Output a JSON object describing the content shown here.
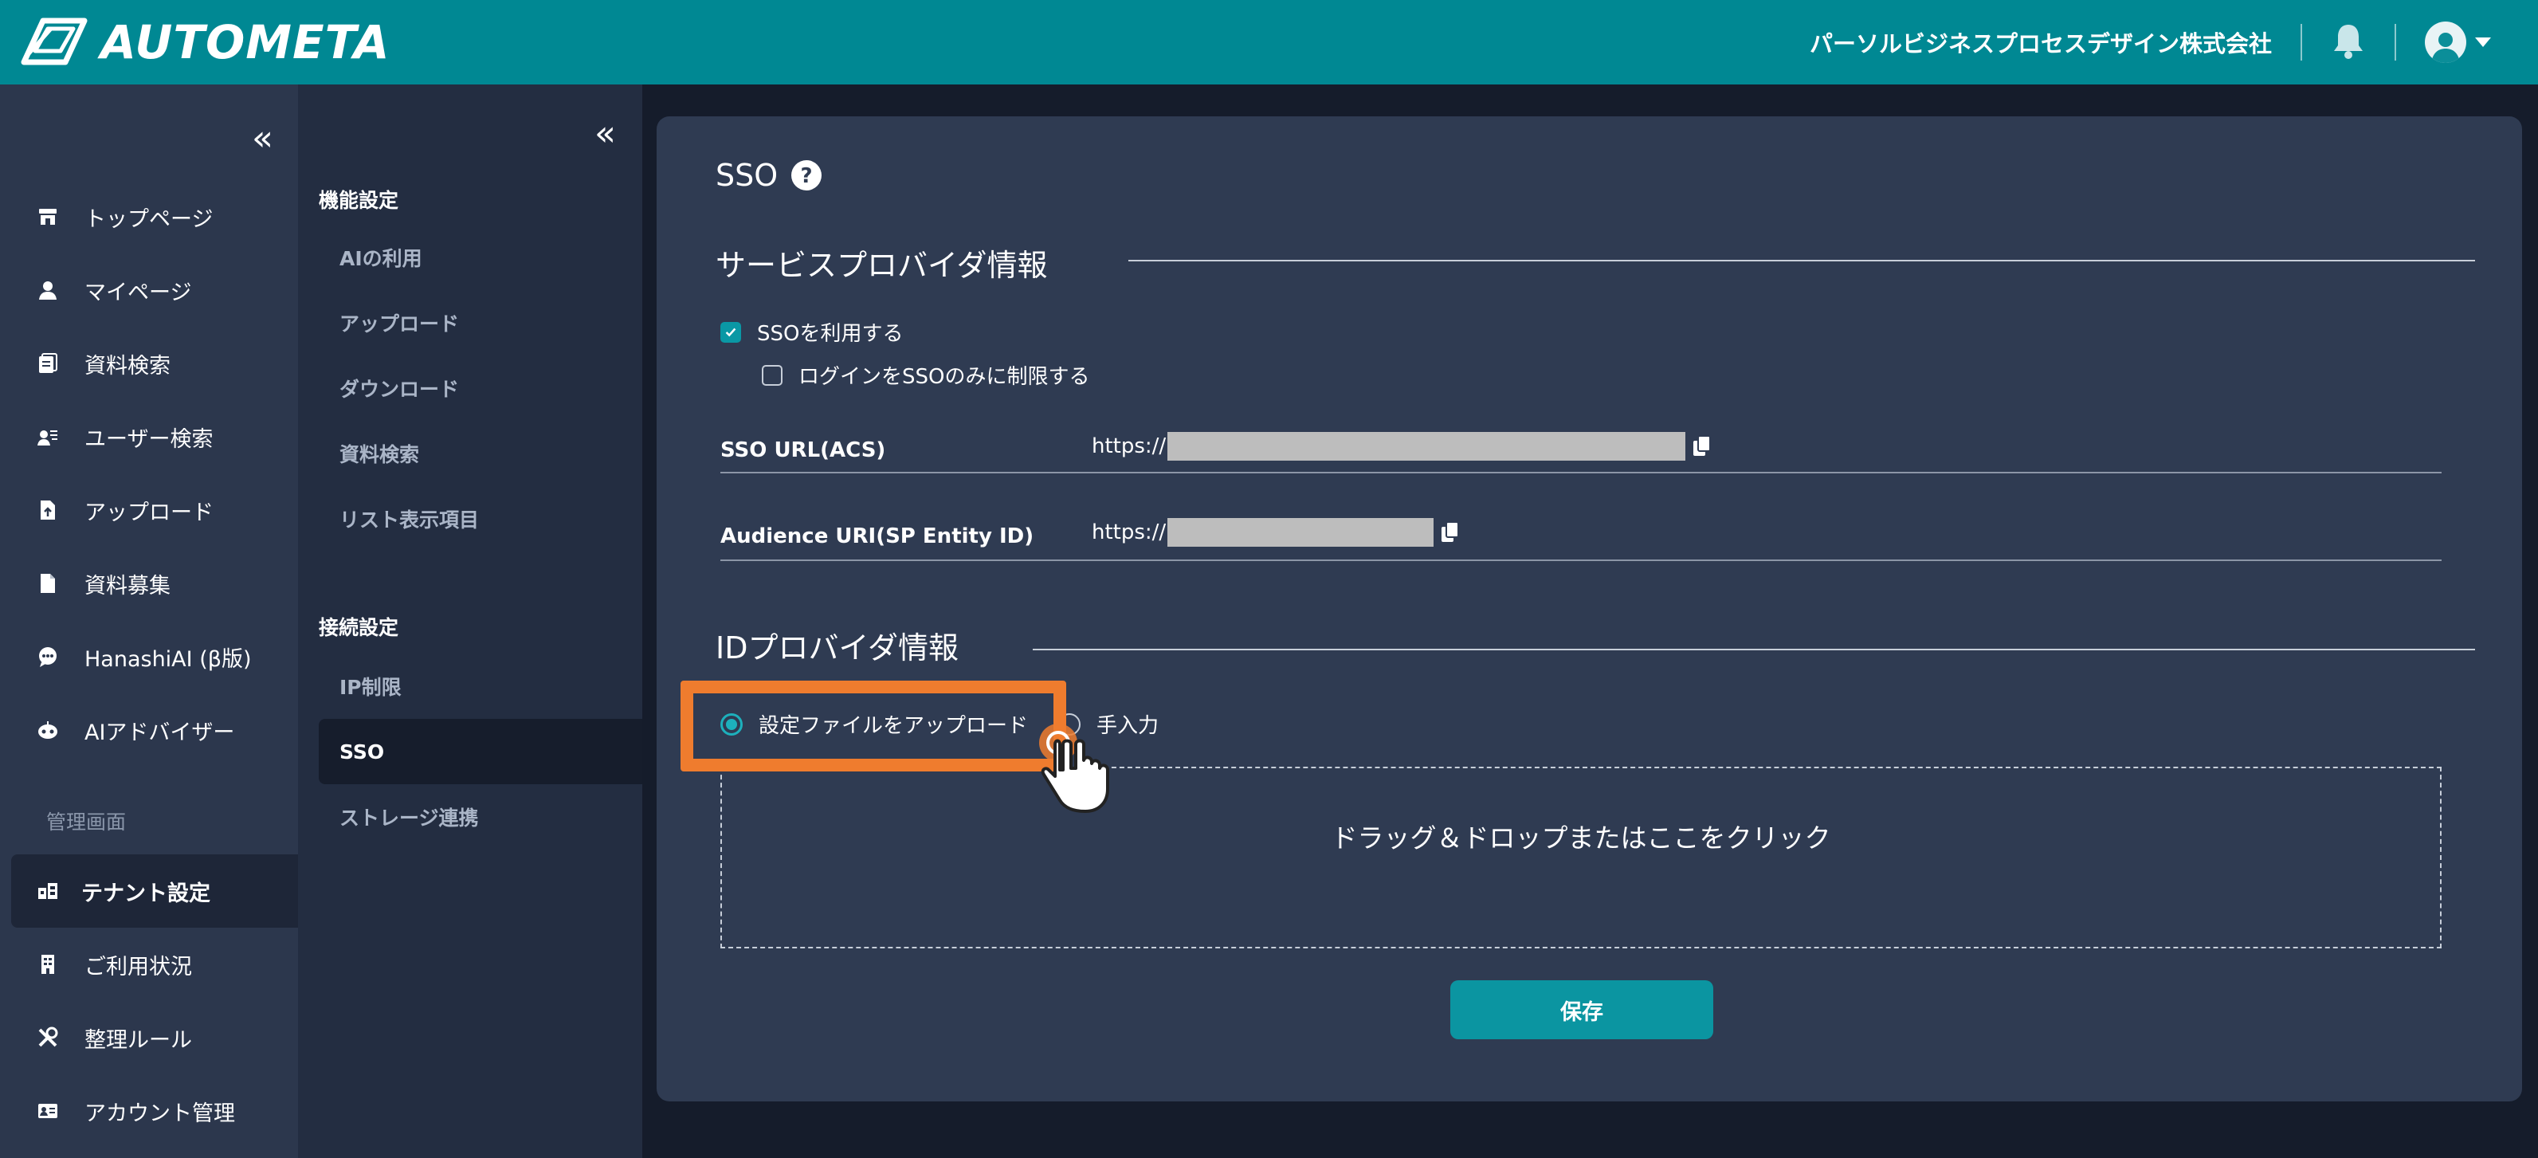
{
  "header": {
    "logo_text": "AUTOMETA",
    "company": "パーソルビジネスプロセスデザイン株式会社",
    "icons": [
      "logo-icon",
      "bell-icon",
      "user-avatar-icon",
      "caret-down-icon"
    ]
  },
  "sidebar": {
    "collapse_glyph": "«",
    "items": [
      {
        "label": "トップページ",
        "icon": "store-icon"
      },
      {
        "label": "マイページ",
        "icon": "person-icon"
      },
      {
        "label": "資料検索",
        "icon": "document-search-icon"
      },
      {
        "label": "ユーザー検索",
        "icon": "user-search-icon"
      },
      {
        "label": "アップロード",
        "icon": "file-upload-icon"
      },
      {
        "label": "資料募集",
        "icon": "file-icon"
      },
      {
        "label": "HanashiAI (β版)",
        "icon": "chat-icon"
      },
      {
        "label": "AIアドバイザー",
        "icon": "robot-icon"
      }
    ],
    "admin_section": "管理画面",
    "admin_items": [
      {
        "label": "テナント設定",
        "icon": "tenant-icon",
        "active": true
      },
      {
        "label": "ご利用状況",
        "icon": "building-icon"
      },
      {
        "label": "整理ルール",
        "icon": "tools-icon"
      },
      {
        "label": "アカウント管理",
        "icon": "id-card-icon"
      }
    ]
  },
  "subnav": {
    "collapse_glyph": "«",
    "groups": [
      {
        "title": "機能設定",
        "items": [
          "AIの利用",
          "アップロード",
          "ダウンロード",
          "資料検索",
          "リスト表示項目"
        ]
      },
      {
        "title": "接続設定",
        "items": [
          "IP制限",
          "SSO",
          "ストレージ連携"
        ]
      }
    ],
    "active_item": "SSO"
  },
  "main": {
    "title": "SSO",
    "sp_section": {
      "title": "サービスプロバイダ情報",
      "use_sso_label": "SSOを利用する",
      "use_sso_checked": true,
      "restrict_label": "ログインをSSOのみに制限する",
      "restrict_checked": false,
      "rows": [
        {
          "label": "SSO URL(ACS)",
          "value_prefix": "https://"
        },
        {
          "label": "Audience URI(SP Entity ID)",
          "value_prefix": "https://"
        }
      ]
    },
    "idp_section": {
      "title": "IDプロバイダ情報",
      "option_upload": "設定ファイルをアップロード",
      "option_manual": "手入力",
      "selected": "設定ファイルをアップロード",
      "dropzone_text": "ドラッグ＆ドロップまたはここをクリック"
    },
    "save_label": "保存"
  },
  "colors": {
    "header": "#008893",
    "sidebar": "#2c374d",
    "subnav": "#232d41",
    "card": "#2f3b52",
    "accent": "#0b95a1",
    "highlight": "#ef7c2e"
  }
}
